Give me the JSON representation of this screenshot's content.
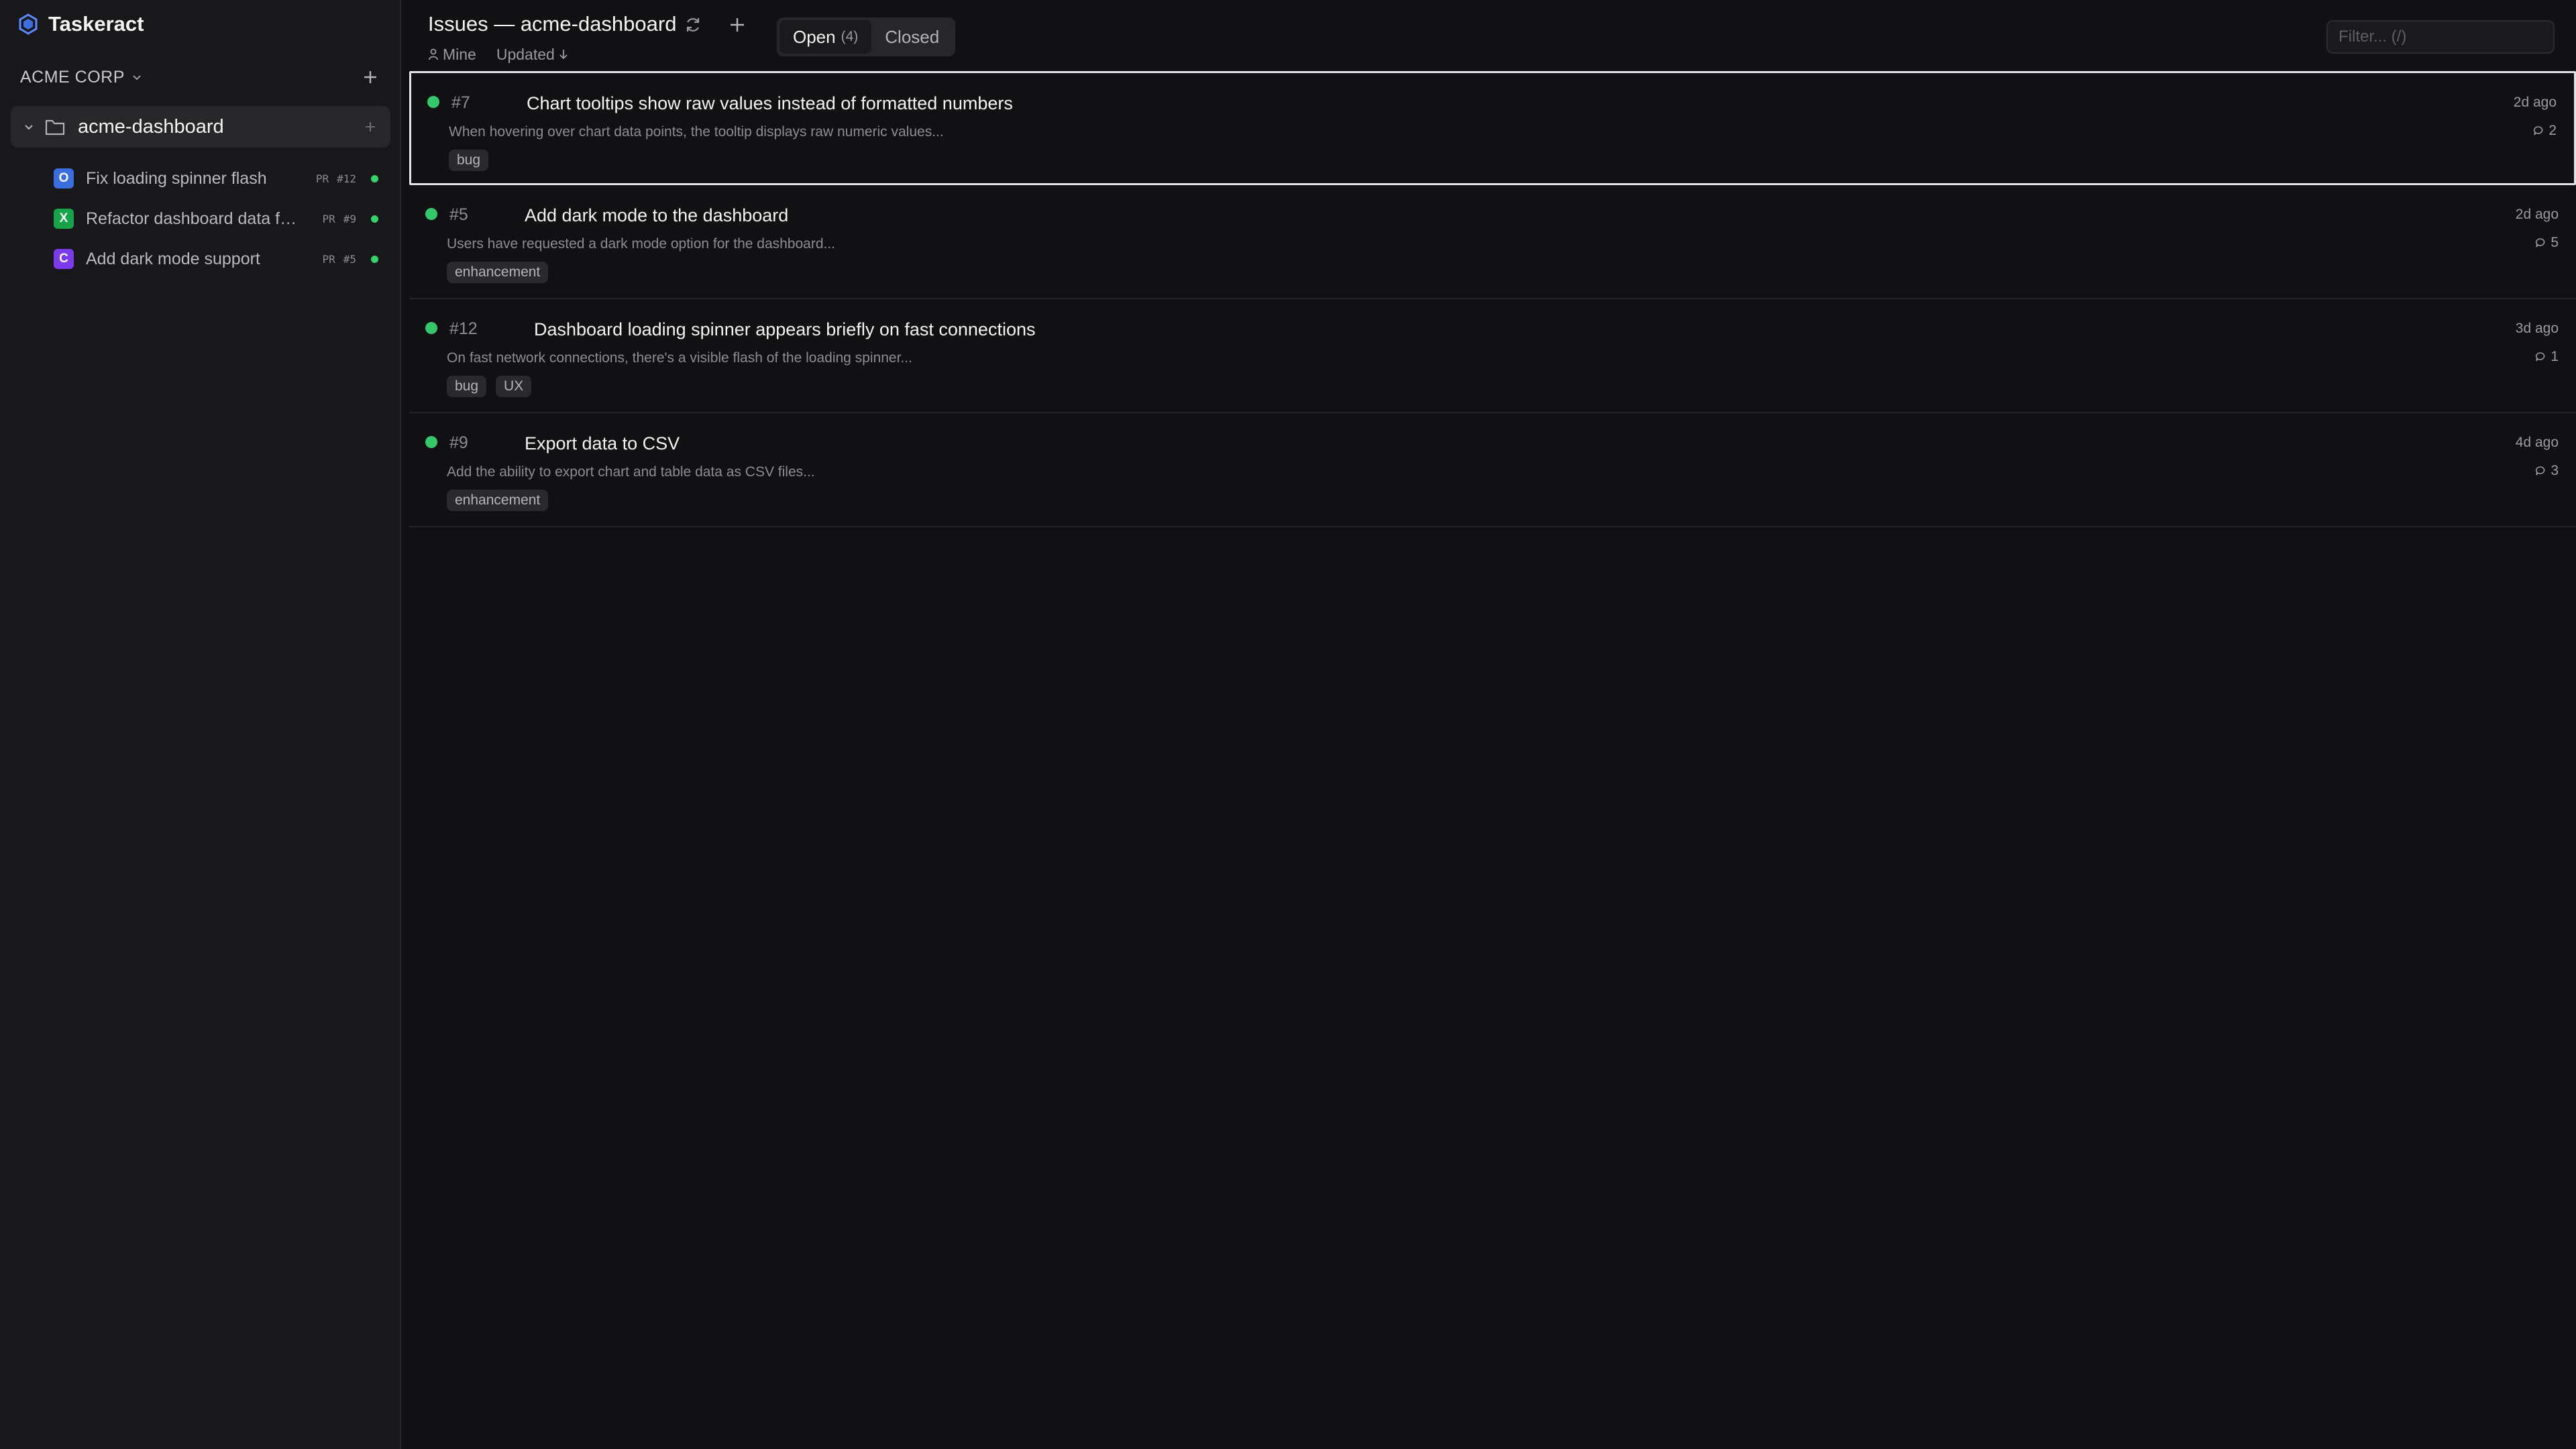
{
  "app": {
    "name": "Taskeract",
    "logo_icon": "hexagon-logo-icon",
    "accent": "#3b6fe0"
  },
  "sidebar": {
    "org_name": "ACME CORP",
    "project": {
      "name": "acme-dashboard"
    },
    "pull_requests": [
      {
        "avatar_letter": "O",
        "avatar_color": "#3b6fe0",
        "title": "Fix loading spinner flash",
        "tag": "PR",
        "number": "#12",
        "status_color": "#34d36b"
      },
      {
        "avatar_letter": "X",
        "avatar_color": "#16a34a",
        "title": "Refactor dashboard data fetching",
        "tag": "PR",
        "number": "#9",
        "status_color": "#34d36b"
      },
      {
        "avatar_letter": "C",
        "avatar_color": "#7c3aed",
        "title": "Add dark mode support",
        "tag": "PR",
        "number": "#5",
        "status_color": "#34d36b"
      }
    ]
  },
  "header": {
    "title": "Issues — acme-dashboard",
    "tabs": {
      "open_label": "Open",
      "open_count": "(4)",
      "closed_label": "Closed"
    },
    "mine_label": "Mine",
    "sort_label": "Updated",
    "filter_placeholder": "Filter... (/)"
  },
  "issues": [
    {
      "number": "#7",
      "title": "Chart tooltips show raw values instead of formatted numbers",
      "description": "When hovering over chart data points, the tooltip displays raw numeric values...",
      "time": "2d ago",
      "comments": "2",
      "labels": [
        "bug"
      ],
      "status_color": "#34c86a"
    },
    {
      "number": "#5",
      "title": "Add dark mode to the dashboard",
      "description": "Users have requested a dark mode option for the dashboard...",
      "time": "2d ago",
      "comments": "5",
      "labels": [
        "enhancement"
      ],
      "status_color": "#34c86a"
    },
    {
      "number": "#12",
      "title": "Dashboard loading spinner appears briefly on fast connections",
      "description": "On fast network connections, there's a visible flash of the loading spinner...",
      "time": "3d ago",
      "comments": "1",
      "labels": [
        "bug",
        "UX"
      ],
      "status_color": "#34c86a"
    },
    {
      "number": "#9",
      "title": "Export data to CSV",
      "description": "Add the ability to export chart and table data as CSV files...",
      "time": "4d ago",
      "comments": "3",
      "labels": [
        "enhancement"
      ],
      "status_color": "#34c86a"
    }
  ]
}
